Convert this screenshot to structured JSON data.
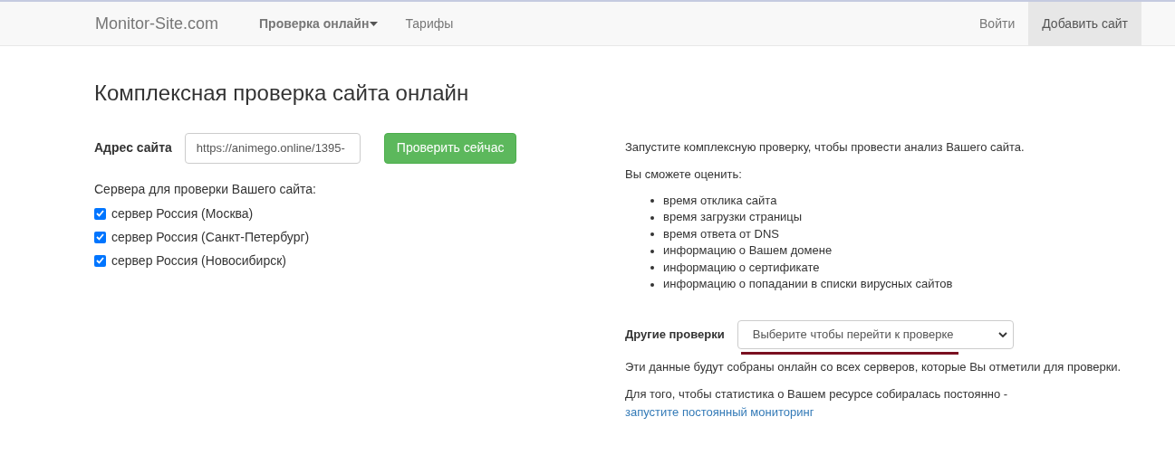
{
  "navbar": {
    "brand": "Monitor-Site.com",
    "left_items": [
      {
        "label": "Проверка онлайн",
        "kind": "dropdown",
        "selected": false
      },
      {
        "label": "Тарифы",
        "kind": "link",
        "selected": false
      }
    ],
    "right_items": [
      {
        "label": "Войти",
        "kind": "link",
        "selected": false
      },
      {
        "label": "Добавить сайт",
        "kind": "link",
        "selected": true
      }
    ]
  },
  "page_title": "Комплексная проверка сайта онлайн",
  "form": {
    "address_label": "Адрес сайта",
    "address_value": "https://animego.online/1395-",
    "submit": "Проверить сейчас",
    "servers_label": "Сервера для проверки Вашего сайта:",
    "servers": [
      {
        "label": "сервер Россия (Москва)",
        "checked": true
      },
      {
        "label": "сервер Россия (Санкт-Петербург)",
        "checked": true
      },
      {
        "label": "сервер Россия (Новосибирск)",
        "checked": true
      }
    ]
  },
  "info": {
    "intro": "Запустите комплексную проверку, чтобы провести анализ Вашего сайта.",
    "can_evaluate": "Вы сможете оценить:",
    "features": [
      "время отклика сайта",
      "время загрузки страницы",
      "время ответа от DNS",
      "информацию о Вашем домене",
      "информацию о сертификате",
      "информацию о попадании в списки вирусных сайтов"
    ],
    "other_checks_label": "Другие проверки",
    "other_checks_select": "Выберите чтобы перейти к проверке",
    "note": "Эти данные будут собраны онлайн со всех серверов, которые Вы отметили для проверки.",
    "monitoring_text": "Для того, чтобы статистика о Вашем ресурсе собиралась постоянно -",
    "monitoring_link": "запустите постоянный мониторинг"
  }
}
